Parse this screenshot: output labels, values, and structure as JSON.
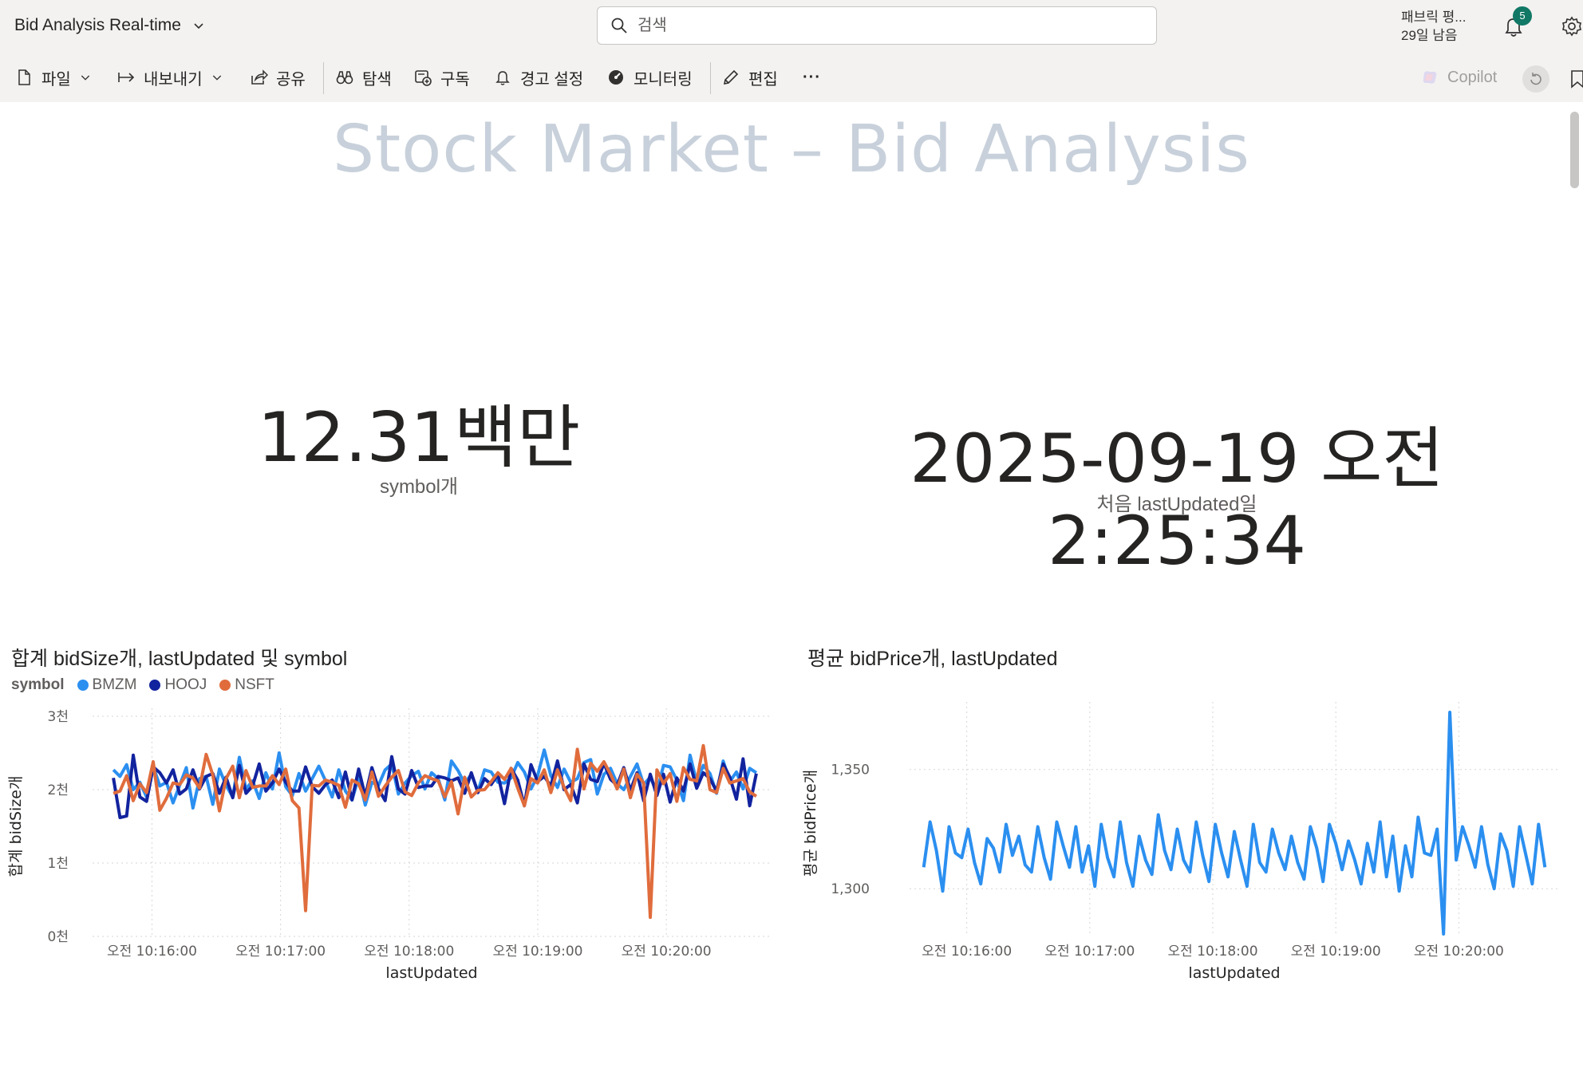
{
  "app": {
    "title": "Bid Analysis Real-time",
    "search_placeholder": "검색",
    "trial_line1": "패브릭 평...",
    "trial_line2": "29일 남음",
    "notification_count": "5"
  },
  "toolbar": {
    "file": "파일",
    "export": "내보내기",
    "share": "공유",
    "explore": "탐색",
    "subscribe": "구독",
    "alert": "경고 설정",
    "monitor": "모니터링",
    "edit": "편집",
    "more": "···",
    "copilot": "Copilot"
  },
  "report": {
    "title": "Stock Market – Bid Analysis",
    "card1": {
      "value": "12.31백만",
      "label": "symbol개"
    },
    "card2": {
      "value": "2025-09-19 오전 2:25:34",
      "label": "처음 lastUpdated일"
    }
  },
  "colors": {
    "BMZM": "#2b8ff0",
    "HOOJ": "#12239e",
    "NSFT": "#e06c3c",
    "avg_line": "#2b8ff0"
  },
  "chart_data": [
    {
      "type": "line",
      "title": "합계 bidSize개, lastUpdated 및 symbol",
      "legend_title": "symbol",
      "xlabel": "lastUpdated",
      "ylabel": "합계 bidSize개",
      "ylim": [
        0,
        3000
      ],
      "yticks": [
        "0천",
        "1천",
        "2천",
        "3천"
      ],
      "xticks": [
        "오전 10:16:00",
        "오전 10:17:00",
        "오전 10:18:00",
        "오전 10:19:00",
        "오전 10:20:00"
      ],
      "xlim_minutes": [
        15.6,
        20.75
      ],
      "series": [
        {
          "name": "BMZM",
          "values": [
            2270,
            2180,
            2340,
            2000,
            2100,
            1900,
            2320,
            2050,
            2100,
            1820,
            2060,
            2300,
            1750,
            2150,
            2180,
            1800,
            2280,
            2060,
            1900,
            2440,
            2010,
            2120,
            1880,
            2230,
            2010,
            2500,
            2040,
            1920,
            2220,
            1980,
            2150,
            2320,
            2120,
            1900,
            2270,
            1980,
            1860,
            2170,
            1790,
            2100,
            2060,
            2270,
            2350,
            1940,
            2090,
            2190,
            2250,
            2010,
            2230,
            2150,
            1860,
            2390,
            2260,
            2080,
            2210,
            1980,
            2270,
            2240,
            2100,
            2090,
            2160,
            2370,
            2240,
            2010,
            2190,
            2540,
            2190,
            2030,
            2280,
            2100,
            2150,
            2370,
            2410,
            1940,
            2210,
            2290,
            2080,
            2000,
            2180,
            2350,
            2070,
            2170,
            1970,
            2330,
            2310,
            2130,
            1850,
            2470,
            2100,
            2330,
            2220,
            1950,
            2390,
            2110,
            2240,
            2010,
            2290,
            2230
          ]
        },
        {
          "name": "HOOJ",
          "values": [
            2160,
            1620,
            1640,
            2470,
            1900,
            1840,
            2310,
            2230,
            2090,
            2270,
            1940,
            2010,
            2270,
            2010,
            2180,
            2220,
            1950,
            2170,
            1890,
            2330,
            1950,
            2050,
            2350,
            1980,
            2090,
            2280,
            2100,
            1980,
            1980,
            2310,
            2040,
            1950,
            2070,
            2130,
            1890,
            2240,
            1860,
            2280,
            1910,
            2300,
            2010,
            1850,
            2450,
            2010,
            1940,
            2260,
            2030,
            2050,
            2050,
            2180,
            2160,
            2120,
            2160,
            1950,
            2230,
            1960,
            2150,
            2070,
            2210,
            1810,
            2290,
            2130,
            1780,
            2340,
            2110,
            2180,
            2050,
            2390,
            2000,
            2070,
            1820,
            2350,
            2140,
            2110,
            2360,
            2140,
            2060,
            2300,
            1990,
            2230,
            1850,
            2210,
            1920,
            2210,
            1830,
            2160,
            1980,
            2350,
            2020,
            2230,
            2150,
            1980,
            2350,
            2170,
            1870,
            2420,
            1780,
            2220
          ]
        },
        {
          "name": "NSFT",
          "values": [
            1950,
            1980,
            2190,
            1850,
            2080,
            1960,
            2380,
            1720,
            1880,
            2090,
            2070,
            2200,
            2160,
            2020,
            2480,
            2200,
            1710,
            2150,
            2320,
            1890,
            2260,
            2030,
            2050,
            2050,
            2190,
            2070,
            2280,
            1850,
            1750,
            350,
            2060,
            2050,
            2130,
            2100,
            2060,
            1760,
            2130,
            2080,
            1860,
            2240,
            1910,
            2050,
            2170,
            2260,
            1970,
            1920,
            2090,
            2190,
            2150,
            2120,
            1900,
            2110,
            1670,
            2170,
            1900,
            1990,
            2000,
            2110,
            2230,
            2140,
            2290,
            2020,
            1780,
            2150,
            2090,
            2270,
            1960,
            2270,
            2030,
            1850,
            2550,
            2010,
            2360,
            2250,
            2380,
            2210,
            2010,
            2280,
            1890,
            2210,
            2090,
            260,
            2270,
            2080,
            2220,
            1840,
            2300,
            2140,
            2120,
            2600,
            2000,
            1960,
            2290,
            2090,
            2120,
            2150,
            1970,
            1910
          ]
        }
      ]
    },
    {
      "type": "line",
      "title": "평균 bidPrice개, lastUpdated",
      "xlabel": "lastUpdated",
      "ylabel": "평균 bidPrice개",
      "yticks": [
        "1,300",
        "1,350"
      ],
      "ylim": [
        1280,
        1375
      ],
      "xticks": [
        "오전 10:16:00",
        "오전 10:17:00",
        "오전 10:18:00",
        "오전 10:19:00",
        "오전 10:20:00"
      ],
      "xlim_minutes": [
        15.6,
        20.75
      ],
      "series": [
        {
          "name": "",
          "values": [
            1309,
            1328,
            1316,
            1299,
            1326,
            1315,
            1313,
            1325,
            1311,
            1302,
            1321,
            1317,
            1307,
            1327,
            1314,
            1322,
            1310,
            1307,
            1326,
            1313,
            1304,
            1328,
            1318,
            1309,
            1326,
            1307,
            1318,
            1301,
            1327,
            1313,
            1305,
            1328,
            1311,
            1301,
            1322,
            1312,
            1306,
            1331,
            1316,
            1308,
            1325,
            1312,
            1307,
            1328,
            1314,
            1303,
            1327,
            1315,
            1305,
            1324,
            1312,
            1301,
            1327,
            1311,
            1307,
            1325,
            1315,
            1308,
            1322,
            1311,
            1304,
            1326,
            1317,
            1303,
            1327,
            1319,
            1308,
            1320,
            1312,
            1302,
            1319,
            1307,
            1328,
            1305,
            1322,
            1299,
            1318,
            1305,
            1330,
            1315,
            1314,
            1325,
            1281,
            1374,
            1312,
            1326,
            1318,
            1309,
            1326,
            1310,
            1300,
            1323,
            1316,
            1301,
            1326,
            1314,
            1302,
            1327,
            1309
          ]
        }
      ]
    }
  ]
}
